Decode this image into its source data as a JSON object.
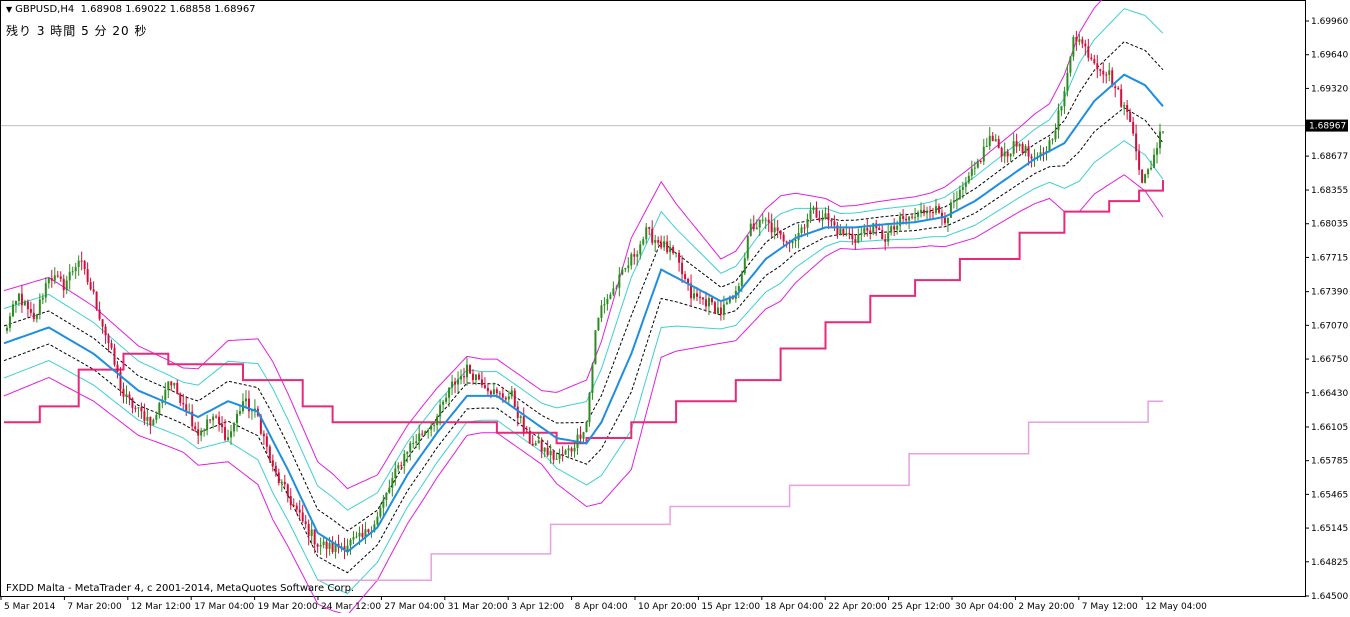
{
  "header": {
    "symbol_label": "GBPUSD,H4",
    "ohlc": "1.68908 1.69022 1.68858 1.68967",
    "countdown": "残り 3 時間 5 分 20 秒"
  },
  "footer": {
    "copyright": "FXDD Malta - MetaTrader 4, c 2001-2014, MetaQuotes Software Corp."
  },
  "colors": {
    "bull_candle": "#2e8b22",
    "bear_candle": "#d0103a",
    "ma_line": "#1e8ee0",
    "bb_outer": "#e020e0",
    "bb_middle": "#40d0d0",
    "bb_inner": "#000000",
    "step_line": "#e8287a",
    "step_line_2": "#e8a0e0",
    "price_line": "#c0c0c0"
  },
  "chart_data": {
    "type": "candlestick",
    "symbol": "GBPUSD",
    "timeframe": "H4",
    "current_price": "1.68967",
    "ylim": [
      1.645,
      1.7015
    ],
    "y_ticks": [
      "1.69960",
      "1.69640",
      "1.69320",
      "1.68967",
      "1.68677",
      "1.68355",
      "1.68035",
      "1.67715",
      "1.67390",
      "1.67070",
      "1.66750",
      "1.66430",
      "1.66105",
      "1.65785",
      "1.65465",
      "1.65145",
      "1.64825",
      "1.64500"
    ],
    "x_ticks": [
      "5 Mar 2014",
      "7 Mar 20:00",
      "12 Mar 12:00",
      "17 Mar 04:00",
      "19 Mar 20:00",
      "24 Mar 12:00",
      "27 Mar 04:00",
      "31 Mar 20:00",
      "3 Apr 12:00",
      "8 Apr 04:00",
      "10 Apr 20:00",
      "15 Apr 12:00",
      "18 Apr 04:00",
      "22 Apr 20:00",
      "25 Apr 12:00",
      "30 Apr 04:00",
      "2 May 20:00",
      "7 May 12:00",
      "12 May 04:00"
    ],
    "close_anchors": [
      [
        0,
        1.67
      ],
      [
        5,
        1.6735
      ],
      [
        10,
        1.671
      ],
      [
        15,
        1.6755
      ],
      [
        20,
        1.6745
      ],
      [
        25,
        1.677
      ],
      [
        30,
        1.6735
      ],
      [
        35,
        1.669
      ],
      [
        40,
        1.664
      ],
      [
        45,
        1.6625
      ],
      [
        50,
        1.6615
      ],
      [
        55,
        1.6655
      ],
      [
        60,
        1.6635
      ],
      [
        65,
        1.6605
      ],
      [
        70,
        1.662
      ],
      [
        75,
        1.66
      ],
      [
        80,
        1.6635
      ],
      [
        85,
        1.662
      ],
      [
        90,
        1.657
      ],
      [
        95,
        1.6545
      ],
      [
        100,
        1.652
      ],
      [
        105,
        1.65
      ],
      [
        110,
        1.6495
      ],
      [
        115,
        1.65
      ],
      [
        120,
        1.6505
      ],
      [
        125,
        1.6525
      ],
      [
        130,
        1.656
      ],
      [
        135,
        1.659
      ],
      [
        140,
        1.6605
      ],
      [
        145,
        1.662
      ],
      [
        150,
        1.665
      ],
      [
        155,
        1.6665
      ],
      [
        160,
        1.6655
      ],
      [
        165,
        1.664
      ],
      [
        170,
        1.664
      ],
      [
        175,
        1.66
      ],
      [
        180,
        1.659
      ],
      [
        185,
        1.658
      ],
      [
        190,
        1.659
      ],
      [
        195,
        1.6615
      ],
      [
        198,
        1.67
      ],
      [
        200,
        1.6725
      ],
      [
        205,
        1.6745
      ],
      [
        210,
        1.677
      ],
      [
        215,
        1.6795
      ],
      [
        220,
        1.6785
      ],
      [
        225,
        1.677
      ],
      [
        230,
        1.6735
      ],
      [
        235,
        1.673
      ],
      [
        240,
        1.672
      ],
      [
        245,
        1.6735
      ],
      [
        250,
        1.68
      ],
      [
        255,
        1.6805
      ],
      [
        260,
        1.679
      ],
      [
        265,
        1.679
      ],
      [
        270,
        1.6815
      ],
      [
        275,
        1.681
      ],
      [
        280,
        1.6795
      ],
      [
        285,
        1.679
      ],
      [
        290,
        1.68
      ],
      [
        295,
        1.679
      ],
      [
        300,
        1.6805
      ],
      [
        305,
        1.681
      ],
      [
        310,
        1.682
      ],
      [
        315,
        1.681
      ],
      [
        320,
        1.683
      ],
      [
        325,
        1.6855
      ],
      [
        330,
        1.6885
      ],
      [
        335,
        1.687
      ],
      [
        340,
        1.688
      ],
      [
        345,
        1.686
      ],
      [
        350,
        1.688
      ],
      [
        355,
        1.6925
      ],
      [
        358,
        1.6985
      ],
      [
        362,
        1.697
      ],
      [
        366,
        1.6955
      ],
      [
        370,
        1.6945
      ],
      [
        374,
        1.692
      ],
      [
        378,
        1.6895
      ],
      [
        381,
        1.684
      ],
      [
        384,
        1.686
      ],
      [
        388,
        1.6897
      ]
    ],
    "ma_anchors": [
      [
        0,
        1.669
      ],
      [
        15,
        1.6705
      ],
      [
        30,
        1.668
      ],
      [
        45,
        1.6645
      ],
      [
        55,
        1.6633
      ],
      [
        65,
        1.662
      ],
      [
        75,
        1.6635
      ],
      [
        85,
        1.6625
      ],
      [
        95,
        1.657
      ],
      [
        105,
        1.651
      ],
      [
        115,
        1.6492
      ],
      [
        125,
        1.6515
      ],
      [
        135,
        1.6565
      ],
      [
        145,
        1.6605
      ],
      [
        155,
        1.664
      ],
      [
        165,
        1.664
      ],
      [
        175,
        1.662
      ],
      [
        185,
        1.66
      ],
      [
        195,
        1.6595
      ],
      [
        200,
        1.6615
      ],
      [
        210,
        1.668
      ],
      [
        220,
        1.676
      ],
      [
        230,
        1.6745
      ],
      [
        240,
        1.673
      ],
      [
        245,
        1.6735
      ],
      [
        255,
        1.677
      ],
      [
        265,
        1.679
      ],
      [
        275,
        1.68
      ],
      [
        285,
        1.68
      ],
      [
        295,
        1.6803
      ],
      [
        305,
        1.6805
      ],
      [
        315,
        1.681
      ],
      [
        325,
        1.6825
      ],
      [
        335,
        1.6845
      ],
      [
        345,
        1.6865
      ],
      [
        355,
        1.688
      ],
      [
        365,
        1.692
      ],
      [
        375,
        1.6945
      ],
      [
        382,
        1.6935
      ],
      [
        388,
        1.6915
      ]
    ],
    "step_line_1": [
      [
        0,
        1.6615
      ],
      [
        12,
        1.663
      ],
      [
        25,
        1.6665
      ],
      [
        40,
        1.668
      ],
      [
        55,
        1.667
      ],
      [
        80,
        1.6655
      ],
      [
        100,
        1.663
      ],
      [
        110,
        1.6615
      ],
      [
        130,
        1.6615
      ],
      [
        165,
        1.6605
      ],
      [
        185,
        1.6595
      ],
      [
        195,
        1.66
      ],
      [
        210,
        1.6615
      ],
      [
        225,
        1.6635
      ],
      [
        245,
        1.6655
      ],
      [
        260,
        1.6685
      ],
      [
        275,
        1.671
      ],
      [
        290,
        1.6735
      ],
      [
        305,
        1.675
      ],
      [
        320,
        1.677
      ],
      [
        340,
        1.6795
      ],
      [
        355,
        1.6815
      ],
      [
        370,
        1.6825
      ],
      [
        380,
        1.6835
      ],
      [
        388,
        1.6845
      ]
    ],
    "step_line_2": [
      [
        105,
        1.6465
      ],
      [
        143,
        1.649
      ],
      [
        183,
        1.6518
      ],
      [
        223,
        1.6535
      ],
      [
        263,
        1.6555
      ],
      [
        303,
        1.6585
      ],
      [
        343,
        1.6615
      ],
      [
        383,
        1.6635
      ],
      [
        388,
        1.6635
      ]
    ],
    "bb_widths": [
      [
        0,
        0.005
      ],
      [
        30,
        0.0045
      ],
      [
        60,
        0.004
      ],
      [
        90,
        0.0075
      ],
      [
        110,
        0.0065
      ],
      [
        125,
        0.005
      ],
      [
        140,
        0.0045
      ],
      [
        160,
        0.0035
      ],
      [
        180,
        0.0035
      ],
      [
        195,
        0.006
      ],
      [
        210,
        0.011
      ],
      [
        225,
        0.007
      ],
      [
        240,
        0.004
      ],
      [
        260,
        0.005
      ],
      [
        280,
        0.002
      ],
      [
        310,
        0.0025
      ],
      [
        325,
        0.0035
      ],
      [
        340,
        0.004
      ],
      [
        350,
        0.0045
      ],
      [
        360,
        0.0085
      ],
      [
        375,
        0.0095
      ],
      [
        388,
        0.0105
      ]
    ],
    "candle_count": 389
  }
}
